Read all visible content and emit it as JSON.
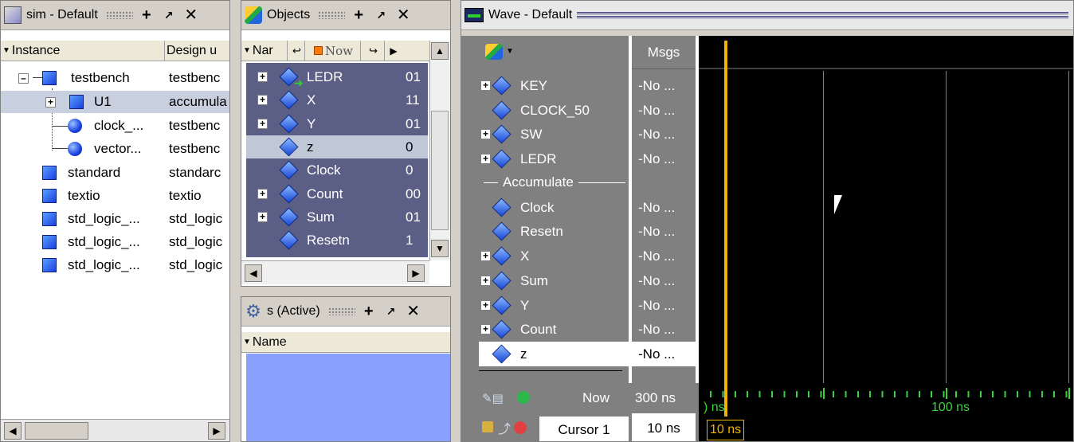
{
  "sim_pane": {
    "title": "sim - Default",
    "columns": [
      "Instance",
      "Design u"
    ],
    "rows": [
      {
        "name": "testbench",
        "design": "testbenc"
      },
      {
        "name": "U1",
        "design": "accumula"
      },
      {
        "name": "clock_...",
        "design": "testbenc"
      },
      {
        "name": "vector...",
        "design": "testbenc"
      },
      {
        "name": "standard",
        "design": "standarc"
      },
      {
        "name": "textio",
        "design": "textio"
      },
      {
        "name": "std_logic_...",
        "design": "std_logic"
      },
      {
        "name": "std_logic_...",
        "design": "std_logic"
      },
      {
        "name": "std_logic_...",
        "design": "std_logic"
      }
    ]
  },
  "objects_pane": {
    "title": "Objects",
    "column_name": "Nar",
    "now_label": "Now",
    "rows": [
      {
        "name": "LEDR",
        "value": "01"
      },
      {
        "name": "X",
        "value": "11"
      },
      {
        "name": "Y",
        "value": "01"
      },
      {
        "name": "z",
        "value": "0"
      },
      {
        "name": "Clock",
        "value": "0"
      },
      {
        "name": "Count",
        "value": "00"
      },
      {
        "name": "Sum",
        "value": "01"
      },
      {
        "name": "Resetn",
        "value": "1"
      }
    ]
  },
  "processes_pane": {
    "title": "s (Active)",
    "column_name": "Name"
  },
  "wave_pane": {
    "title": "Wave - Default",
    "msgs_header": "Msgs",
    "group_label": "Accumulate",
    "signals": [
      {
        "name": "KEY",
        "msg": "-No ..."
      },
      {
        "name": "CLOCK_50",
        "msg": "-No ..."
      },
      {
        "name": "SW",
        "msg": "-No ..."
      },
      {
        "name": "LEDR",
        "msg": "-No ..."
      },
      {
        "name": "Clock",
        "msg": "-No ..."
      },
      {
        "name": "Resetn",
        "msg": "-No ..."
      },
      {
        "name": "X",
        "msg": "-No ..."
      },
      {
        "name": "Sum",
        "msg": "-No ..."
      },
      {
        "name": "Y",
        "msg": "-No ..."
      },
      {
        "name": "Count",
        "msg": "-No ..."
      },
      {
        "name": "z",
        "msg": "-No ..."
      }
    ],
    "now_label": "Now",
    "now_value": "300 ns",
    "cursor_label": "Cursor 1",
    "cursor_value": "10 ns",
    "timeline_start": ") ns",
    "timeline_100": "100 ns",
    "cursor_tag": "10 ns"
  },
  "colors": {
    "selection_bg": "#5b5f86",
    "wave_bg": "#000000",
    "cursor_color": "#f0b400",
    "grid_color": "#808080",
    "timeline_green": "#3cd23c"
  }
}
